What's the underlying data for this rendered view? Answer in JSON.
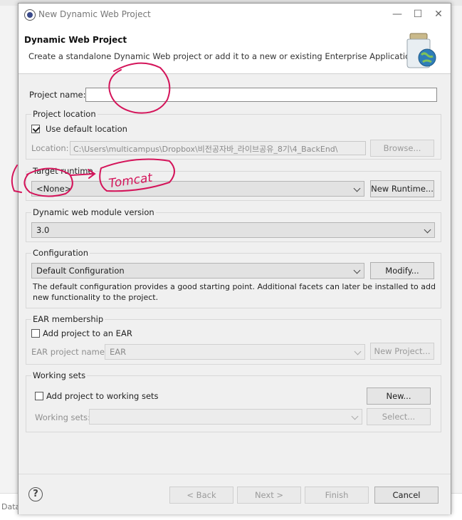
{
  "window": {
    "title": "New Dynamic Web Project",
    "minimize": "—",
    "maximize": "☐",
    "close": "✕"
  },
  "header": {
    "title": "Dynamic Web Project",
    "description": "Create a standalone Dynamic Web project or add it to a new or existing Enterprise Application."
  },
  "project_name": {
    "label": "Project name:",
    "value": ""
  },
  "project_location": {
    "group_label": "Project location",
    "use_default_label": "Use default location",
    "use_default_checked": true,
    "location_label": "Location:",
    "location_value": "C:\\Users\\multicampus\\Dropbox\\비전공자바_라이브공유_8기\\4_BackEnd\\",
    "browse_label": "Browse..."
  },
  "target_runtime": {
    "group_label": "Target runtime",
    "selected": "<None>",
    "new_runtime_label": "New Runtime..."
  },
  "module_version": {
    "group_label": "Dynamic web module version",
    "selected": "3.0"
  },
  "configuration": {
    "group_label": "Configuration",
    "selected": "Default Configuration",
    "modify_label": "Modify...",
    "description_line1": "The default configuration provides a good starting point. Additional facets can later be installed to add",
    "description_line2": "new functionality to the project."
  },
  "ear": {
    "group_label": "EAR membership",
    "add_label": "Add project to an EAR",
    "add_checked": false,
    "name_label": "EAR project name:",
    "name_value": "EAR",
    "new_project_label": "New Project..."
  },
  "working_sets": {
    "group_label": "Working sets",
    "add_label": "Add project to working sets",
    "add_checked": false,
    "new_label": "New...",
    "sets_label": "Working sets:",
    "sets_value": "",
    "select_label": "Select..."
  },
  "footer": {
    "help": "?",
    "back": "< Back",
    "next": "Next >",
    "finish": "Finish",
    "cancel": "Cancel"
  },
  "annotation": {
    "text": "Tomcat",
    "color": "#d4145a"
  },
  "background": {
    "status_text": "Data"
  }
}
